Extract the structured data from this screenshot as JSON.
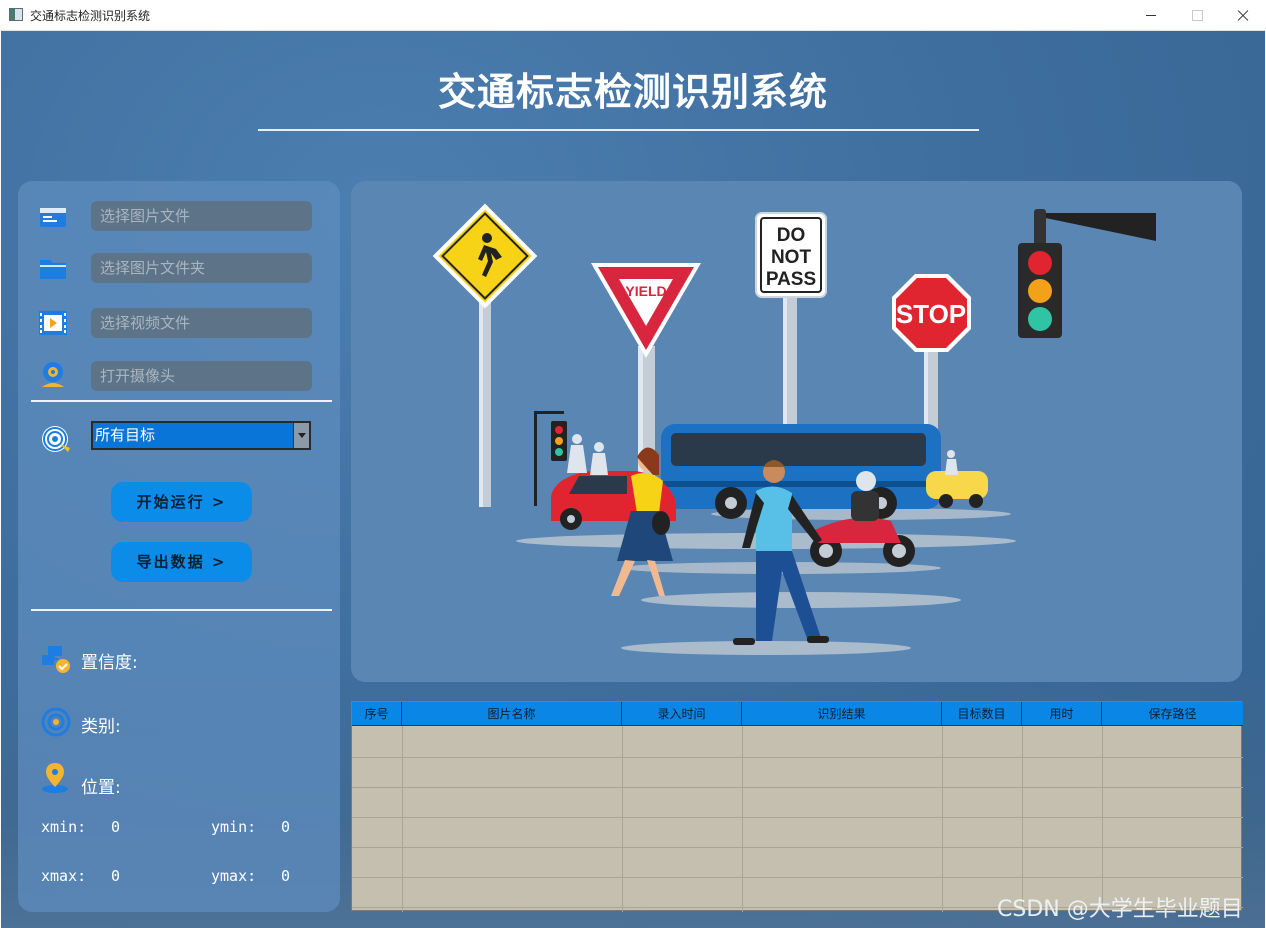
{
  "window": {
    "title": "交通标志检测识别系统"
  },
  "header": {
    "title": "交通标志检测识别系统"
  },
  "left_panel": {
    "inputs": [
      {
        "placeholder": "选择图片文件",
        "icon": "image-file-icon"
      },
      {
        "placeholder": "选择图片文件夹",
        "icon": "folder-icon"
      },
      {
        "placeholder": "选择视频文件",
        "icon": "video-file-icon"
      },
      {
        "placeholder": "打开摄像头",
        "icon": "camera-icon"
      }
    ],
    "target_select": {
      "selected": "所有目标",
      "icon": "target-icon"
    },
    "buttons": {
      "start": "开始运行 >",
      "export": "导出数据 >"
    },
    "info": {
      "confidence_label": "置信度:",
      "category_label": "类别:",
      "position_label": "位置:",
      "xmin_label": "xmin:",
      "xmin_value": "0",
      "ymin_label": "ymin:",
      "ymin_value": "0",
      "xmax_label": "xmax:",
      "xmax_value": "0",
      "ymax_label": "ymax:",
      "ymax_value": "0"
    }
  },
  "image_panel": {
    "signs": {
      "yield": "YIELD",
      "do_not_pass_1": "DO",
      "do_not_pass_2": "NOT",
      "do_not_pass_3": "PASS",
      "stop": "STOP"
    }
  },
  "table": {
    "columns": [
      "序号",
      "图片名称",
      "录入时间",
      "识别结果",
      "目标数目",
      "用时",
      "保存路径"
    ],
    "rows": []
  },
  "watermark": "CSDN @大学生毕业题目",
  "colors": {
    "background": "#3f6f9f",
    "panel": "#5e8cbe",
    "accent_blue": "#0a8ce8",
    "table_body": "#c4bfae"
  }
}
